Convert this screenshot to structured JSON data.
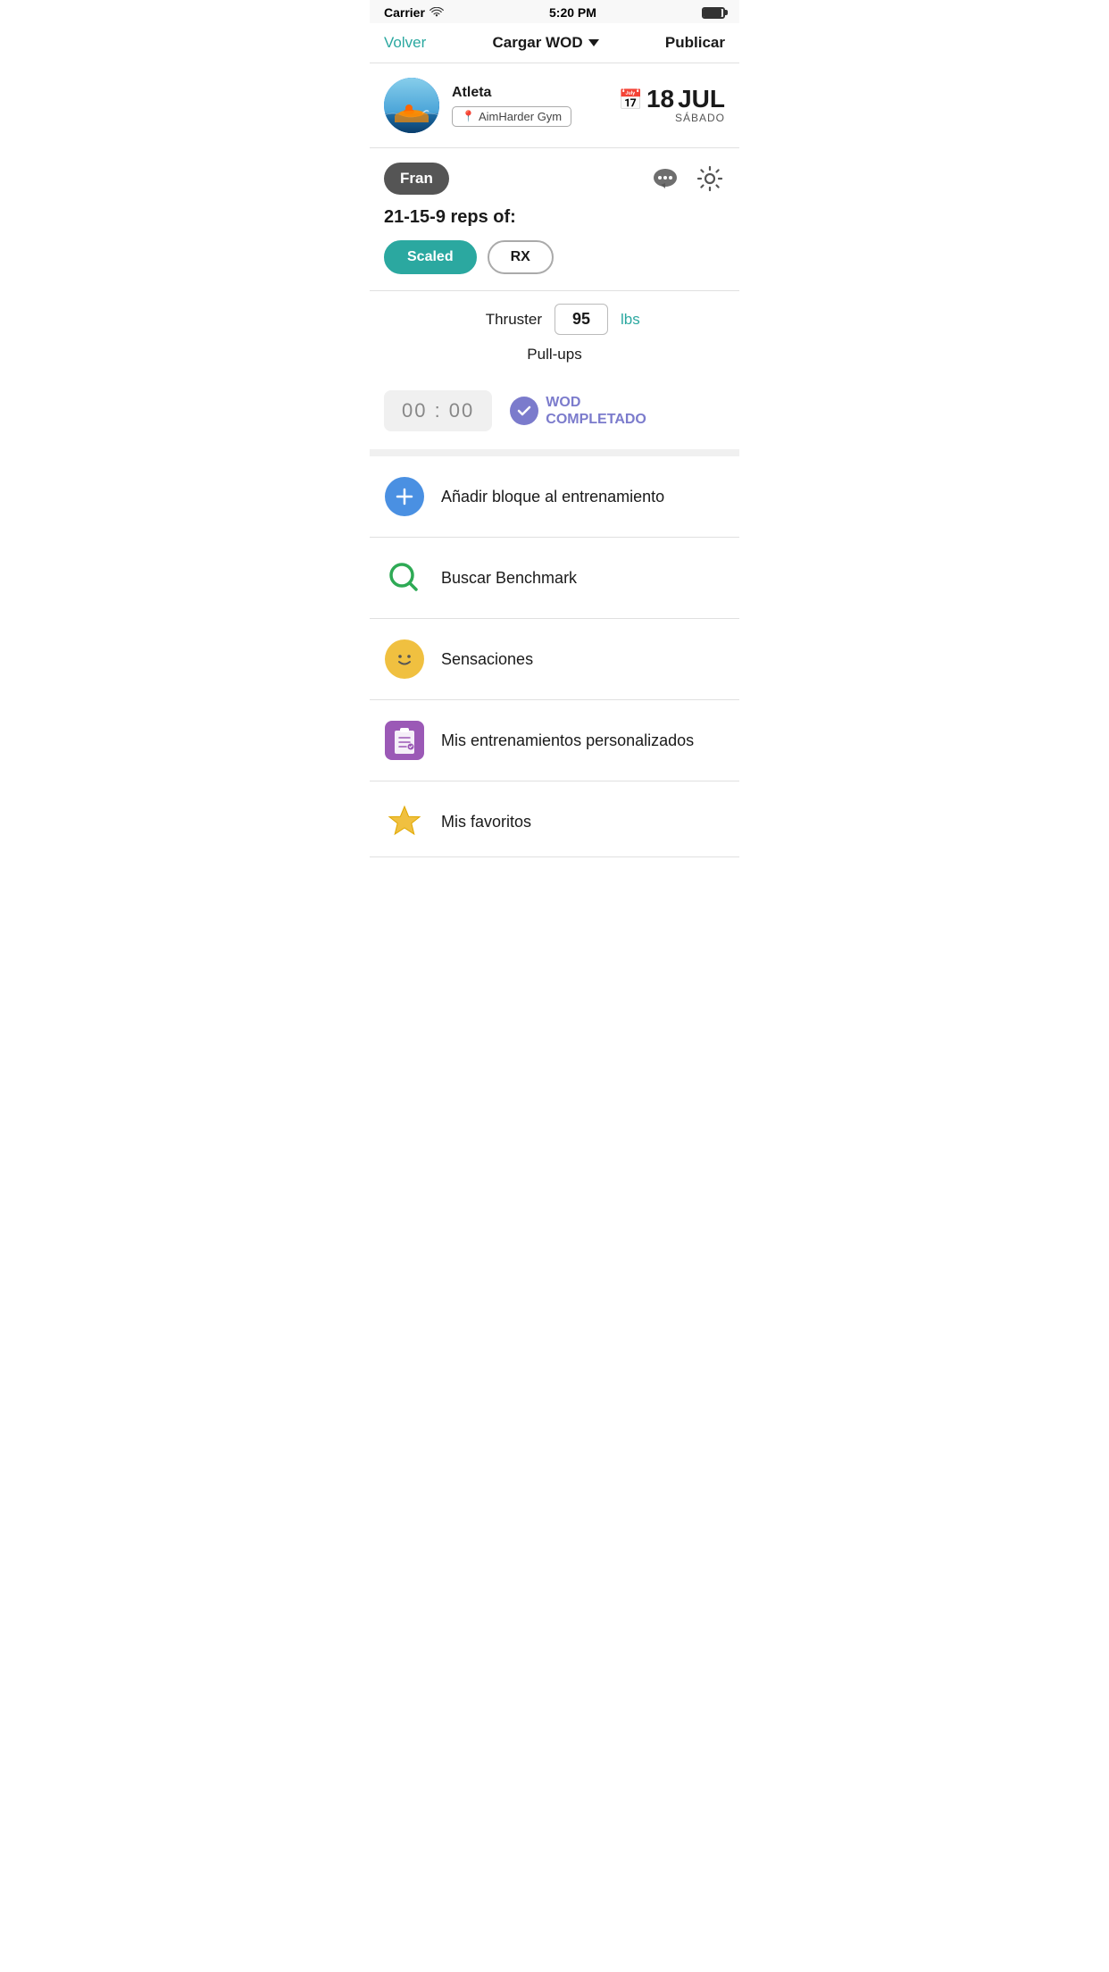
{
  "statusBar": {
    "carrier": "Carrier",
    "time": "5:20 PM"
  },
  "navBar": {
    "backLabel": "Volver",
    "titleLabel": "Cargar WOD",
    "publishLabel": "Publicar"
  },
  "athlete": {
    "name": "Atleta",
    "gym": "AimHarder Gym"
  },
  "date": {
    "day": "18",
    "month": "JUL",
    "weekday": "SÁBADO"
  },
  "wod": {
    "name": "Fran",
    "description": "21-15-9 reps of:",
    "scaledLabel": "Scaled",
    "rxLabel": "RX",
    "exercises": [
      {
        "name": "Thruster",
        "value": "95",
        "unit": "lbs"
      },
      {
        "name": "Pull-ups",
        "value": null,
        "unit": null
      }
    ],
    "timerDisplay": "00 : 00",
    "completedLabel": "WOD\nCOMPLETADO"
  },
  "menuItems": [
    {
      "id": "add-block",
      "label": "Añadir bloque al entrenamiento",
      "iconType": "blue-plus"
    },
    {
      "id": "search-benchmark",
      "label": "Buscar Benchmark",
      "iconType": "green-search"
    },
    {
      "id": "sensaciones",
      "label": "Sensaciones",
      "iconType": "yellow-face"
    },
    {
      "id": "mis-entrenamientos",
      "label": "Mis entrenamientos personalizados",
      "iconType": "purple-clipboard"
    },
    {
      "id": "mis-favoritos",
      "label": "Mis favoritos",
      "iconType": "yellow-star"
    }
  ]
}
